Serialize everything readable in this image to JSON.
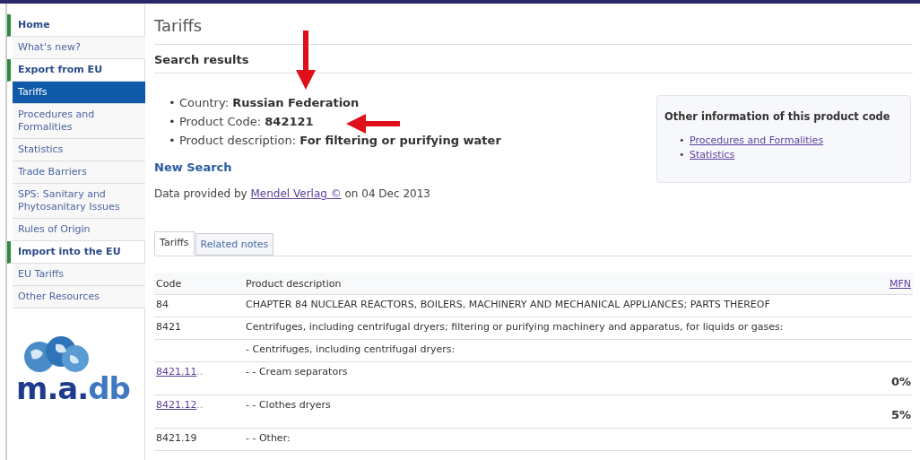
{
  "sidebar": {
    "items": [
      {
        "kind": "section",
        "label": "Home",
        "selected": false
      },
      {
        "kind": "item",
        "label": "What's new?",
        "selected": false
      },
      {
        "kind": "section",
        "label": "Export from EU",
        "selected": false
      },
      {
        "kind": "item",
        "label": "Tariffs",
        "selected": true
      },
      {
        "kind": "item",
        "label": "Procedures and Formalities",
        "selected": false
      },
      {
        "kind": "item",
        "label": "Statistics",
        "selected": false
      },
      {
        "kind": "item",
        "label": "Trade Barriers",
        "selected": false
      },
      {
        "kind": "item",
        "label": "SPS: Sanitary and Phytosanitary Issues",
        "selected": false
      },
      {
        "kind": "item",
        "label": "Rules of Origin",
        "selected": false
      },
      {
        "kind": "section",
        "label": "Import into the EU",
        "selected": false
      },
      {
        "kind": "item",
        "label": "EU Tariffs",
        "selected": false
      },
      {
        "kind": "item",
        "label": "Other Resources",
        "selected": false
      }
    ],
    "logo": {
      "letters": [
        {
          "text": "m.",
          "color": "#1f3c8c"
        },
        {
          "text": "a.",
          "color": "#1f3c8c"
        },
        {
          "text": "db",
          "color": "#3f78bf"
        }
      ]
    }
  },
  "page": {
    "title": "Tariffs",
    "subtitle": "Search results",
    "marker": "•",
    "facts": [
      {
        "label": "Country:",
        "value": "Russian Federation"
      },
      {
        "label": "Product Code:",
        "value": "842121"
      },
      {
        "label": "Product description:",
        "value": "For filtering or purifying water"
      }
    ],
    "new_search": "New Search",
    "source": {
      "before": "Data provided by",
      "link": "Mendel Verlag ©",
      "after": "on 04 Dec 2013"
    },
    "side_box": {
      "marker": "•",
      "title": "Other information of this product code",
      "links": [
        "Procedures and Formalities",
        "Statistics"
      ]
    }
  },
  "tabs": [
    {
      "label": "Tariffs",
      "selected": true
    },
    {
      "label": "Related notes",
      "selected": false
    }
  ],
  "table": {
    "columns": [
      "Code",
      "Product description",
      "MFN"
    ],
    "rows": [
      {
        "code": "84",
        "link": false,
        "more": "",
        "description": "CHAPTER 84 NUCLEAR REACTORS, BOILERS, MACHINERY AND MECHANICAL APPLIANCES; PARTS THEREOF",
        "mfn": ""
      },
      {
        "code": "8421",
        "link": false,
        "more": "",
        "description": "Centrifuges, including centrifugal dryers; filtering or purifying machinery and apparatus, for liquids or gases:",
        "mfn": ""
      },
      {
        "description": "- Centrifuges, including centrifugal dryers:",
        "mfn": ""
      },
      {
        "code": "8421.11",
        "link": true,
        "more": "..",
        "description": "- - Cream separators",
        "mfn": "0%"
      },
      {
        "code": "8421.12",
        "link": true,
        "more": "..",
        "description": "- - Clothes dryers",
        "mfn": "5%"
      },
      {
        "code": "8421.19",
        "link": false,
        "more": "",
        "description": "- - Other:",
        "mfn": ""
      }
    ]
  }
}
